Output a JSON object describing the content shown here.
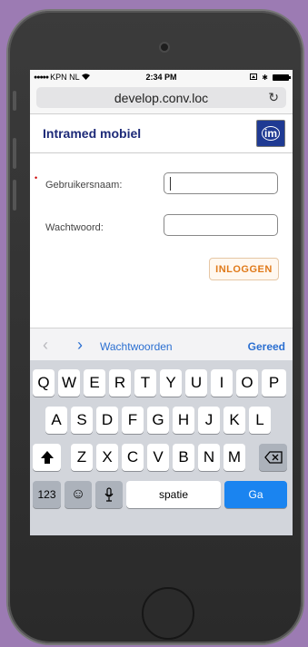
{
  "status_bar": {
    "carrier": "KPN NL",
    "time": "2:34 PM"
  },
  "browser": {
    "url": "develop.conv.loc",
    "reload_icon": "reload-icon"
  },
  "app": {
    "title": "Intramed mobiel",
    "logo_text": "im"
  },
  "form": {
    "username_label": "Gebruikersnaam:",
    "username_value": "",
    "password_label": "Wachtwoord:",
    "password_value": "",
    "login_button": "INLOGGEN"
  },
  "accessory_bar": {
    "passwords_link": "Wachtwoorden",
    "done_button": "Gereed"
  },
  "keyboard": {
    "row1": [
      "Q",
      "W",
      "E",
      "R",
      "T",
      "Y",
      "U",
      "I",
      "O",
      "P"
    ],
    "row2": [
      "A",
      "S",
      "D",
      "F",
      "G",
      "H",
      "J",
      "K",
      "L"
    ],
    "row3": [
      "Z",
      "X",
      "C",
      "V",
      "B",
      "N",
      "M"
    ],
    "numbers_key": "123",
    "space_key": "spatie",
    "go_key": "Ga"
  },
  "colors": {
    "accent_blue": "#2b6fd1",
    "brand_navy": "#1d2a78",
    "login_orange": "#e07a1a",
    "go_blue": "#1a84f0"
  }
}
